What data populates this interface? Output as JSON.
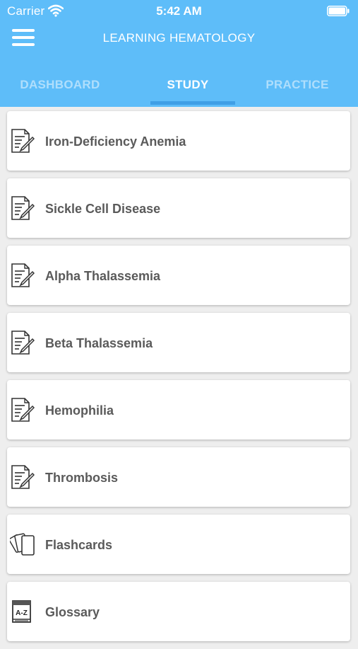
{
  "status_bar": {
    "carrier": "Carrier",
    "time": "5:42 AM"
  },
  "header": {
    "title": "LEARNING HEMATOLOGY"
  },
  "tabs": [
    {
      "label": "DASHBOARD"
    },
    {
      "label": "STUDY"
    },
    {
      "label": "PRACTICE"
    }
  ],
  "active_tab": "STUDY",
  "items": [
    {
      "label": "Iron-Deficiency Anemia",
      "icon": "document-edit-icon"
    },
    {
      "label": "Sickle Cell Disease",
      "icon": "document-edit-icon"
    },
    {
      "label": "Alpha Thalassemia",
      "icon": "document-edit-icon"
    },
    {
      "label": "Beta Thalassemia",
      "icon": "document-edit-icon"
    },
    {
      "label": "Hemophilia",
      "icon": "document-edit-icon"
    },
    {
      "label": "Thrombosis",
      "icon": "document-edit-icon"
    },
    {
      "label": "Flashcards",
      "icon": "flashcards-icon"
    },
    {
      "label": "Glossary",
      "icon": "glossary-book-icon",
      "icon_text": "A-Z"
    }
  ],
  "colors": {
    "header": "#5ebdf9",
    "tab_indicator": "#3f9fe6",
    "label": "#5a5a5a"
  }
}
